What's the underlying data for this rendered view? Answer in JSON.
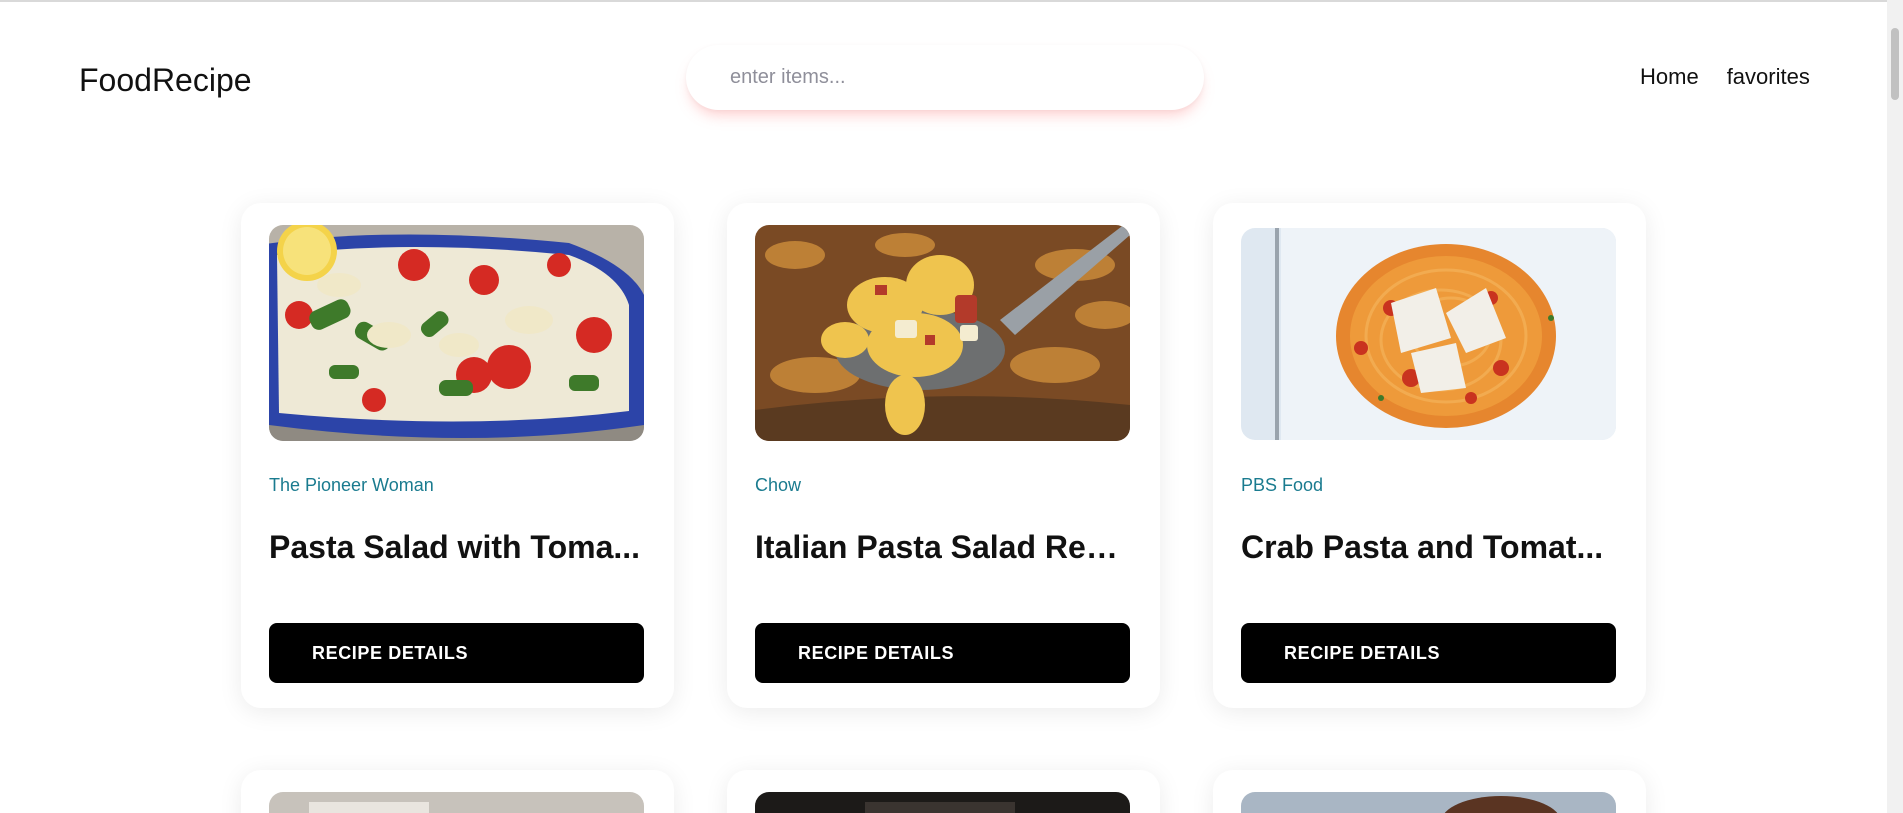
{
  "header": {
    "logo": "FoodRecipe",
    "search": {
      "placeholder": "enter items...",
      "value": ""
    },
    "nav": [
      {
        "label": "Home"
      },
      {
        "label": "favorites"
      }
    ]
  },
  "recipes": [
    {
      "publisher": "The Pioneer Woman",
      "title": "Pasta Salad with Toma...",
      "button": "RECIPE DETAILS",
      "image": "pasta-salad-photo"
    },
    {
      "publisher": "Chow",
      "title": "Italian Pasta Salad Rec...",
      "button": "RECIPE DETAILS",
      "image": "fusilli-on-spoon-photo"
    },
    {
      "publisher": "PBS Food",
      "title": "Crab Pasta and Tomat...",
      "button": "RECIPE DETAILS",
      "image": "spaghetti-with-parmesan-photo"
    }
  ],
  "colors": {
    "accent": "#1a7b8f",
    "button_bg": "#000000",
    "search_glow": "#ff7878"
  }
}
